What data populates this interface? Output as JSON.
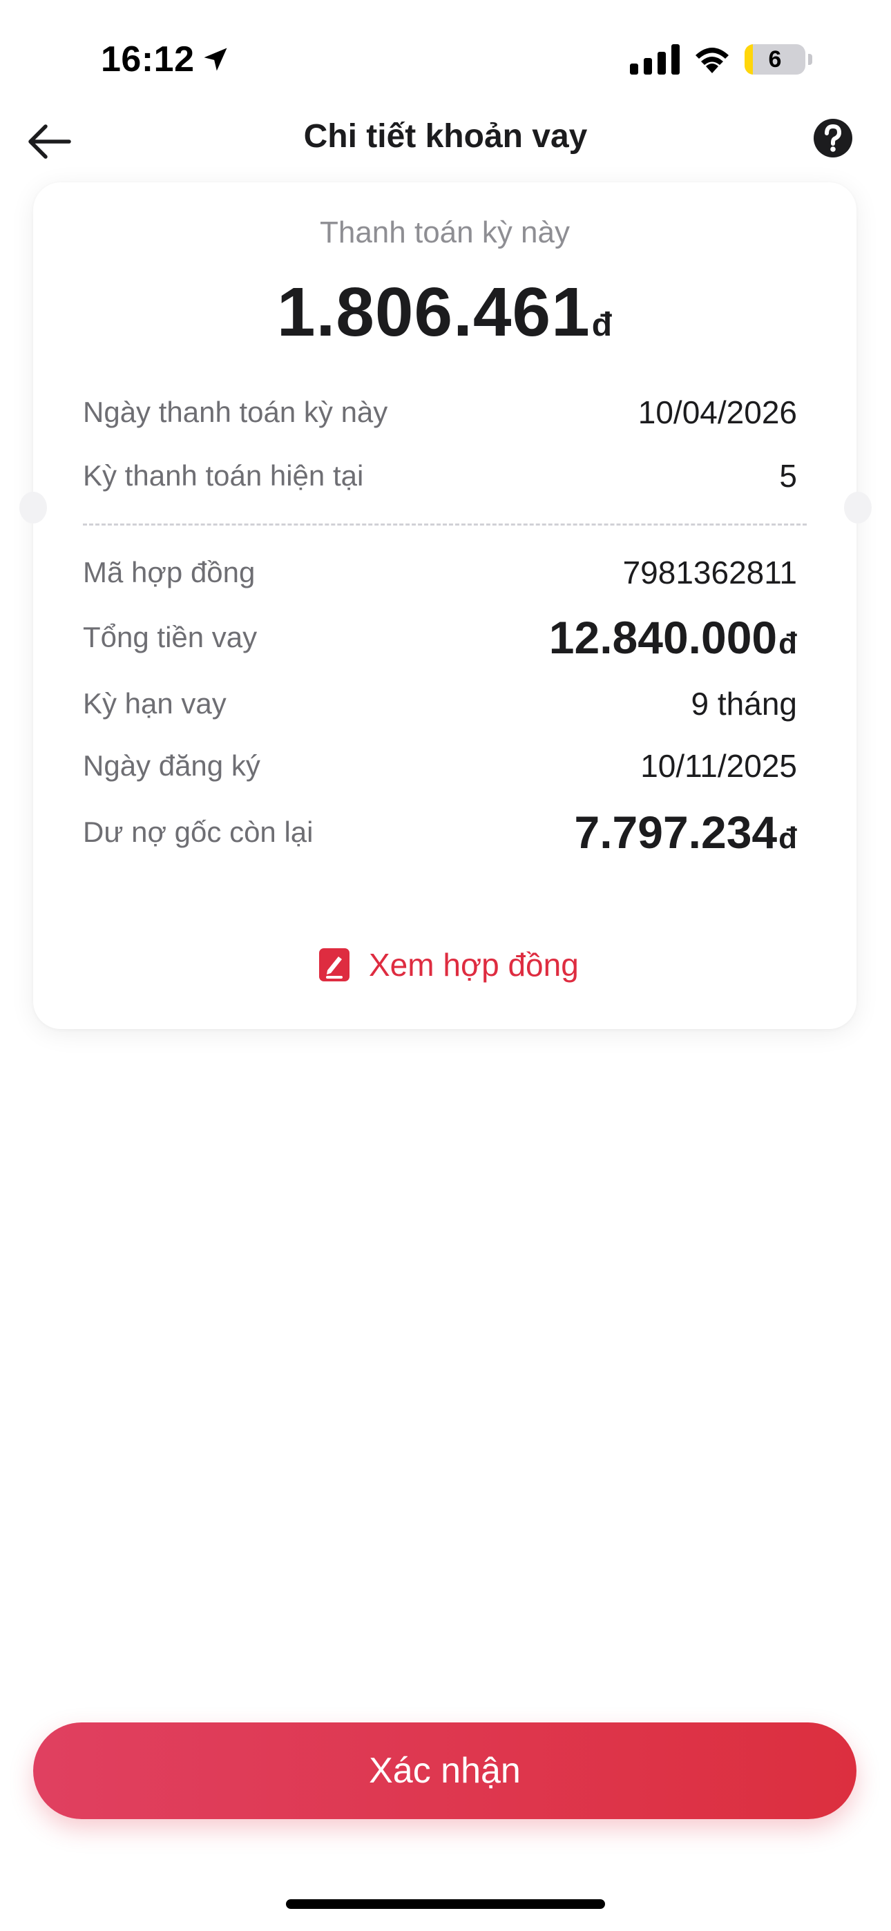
{
  "status_bar": {
    "time": "16:12",
    "battery_level": "6"
  },
  "nav": {
    "title": "Chi tiết khoản vay"
  },
  "payment": {
    "label": "Thanh toán kỳ này",
    "amount": "1.806.461",
    "currency": "đ"
  },
  "schedule": [
    {
      "label": "Ngày thanh toán kỳ này",
      "value": "10/04/2026"
    },
    {
      "label": "Kỳ thanh toán hiện tại",
      "value": "5"
    }
  ],
  "details": {
    "contract_id": {
      "label": "Mã hợp đồng",
      "value": "7981362811"
    },
    "total_loan": {
      "label": "Tổng tiền vay",
      "value": "12.840.000",
      "currency": "đ"
    },
    "term": {
      "label": "Kỳ hạn vay",
      "value": "9 tháng"
    },
    "register_date": {
      "label": "Ngày đăng ký",
      "value": "10/11/2025"
    },
    "remaining_principal": {
      "label": "Dư nợ gốc còn lại",
      "value": "7.797.234",
      "currency": "đ"
    }
  },
  "contract_link": {
    "label": "Xem hợp đồng",
    "icon": "document-edit-icon"
  },
  "confirm_button": {
    "label": "Xác nhận"
  },
  "colors": {
    "accent": "#de2c40",
    "button_start": "#e04060",
    "button_end": "#dc2f3f"
  }
}
